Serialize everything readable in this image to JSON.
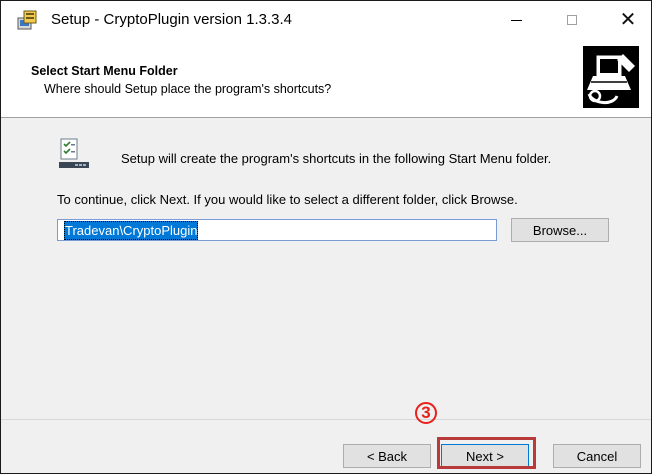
{
  "window": {
    "title": "Setup - CryptoPlugin version 1.3.3.4",
    "controls": {
      "minimize": "—",
      "maximize": "☐",
      "close": "✕"
    }
  },
  "header": {
    "title": "Select Start Menu Folder",
    "subtitle": "Where should Setup place the program's shortcuts?"
  },
  "content": {
    "intro": "Setup will create the program's shortcuts in the following Start Menu folder.",
    "instruction": "To continue, click Next. If you would like to select a different folder, click Browse.",
    "folder_value": "Tradevan\\CryptoPlugin",
    "browse_label": "Browse..."
  },
  "footer": {
    "back_label": "< Back",
    "next_label": "Next >",
    "cancel_label": "Cancel"
  },
  "annotation": {
    "step_marker": "3",
    "highlight_color": "#b93a3a",
    "marker_color": "#e8201c"
  },
  "icons": [
    "setup-app-icon",
    "installer-computer-icon",
    "start-menu-folder-icon"
  ]
}
